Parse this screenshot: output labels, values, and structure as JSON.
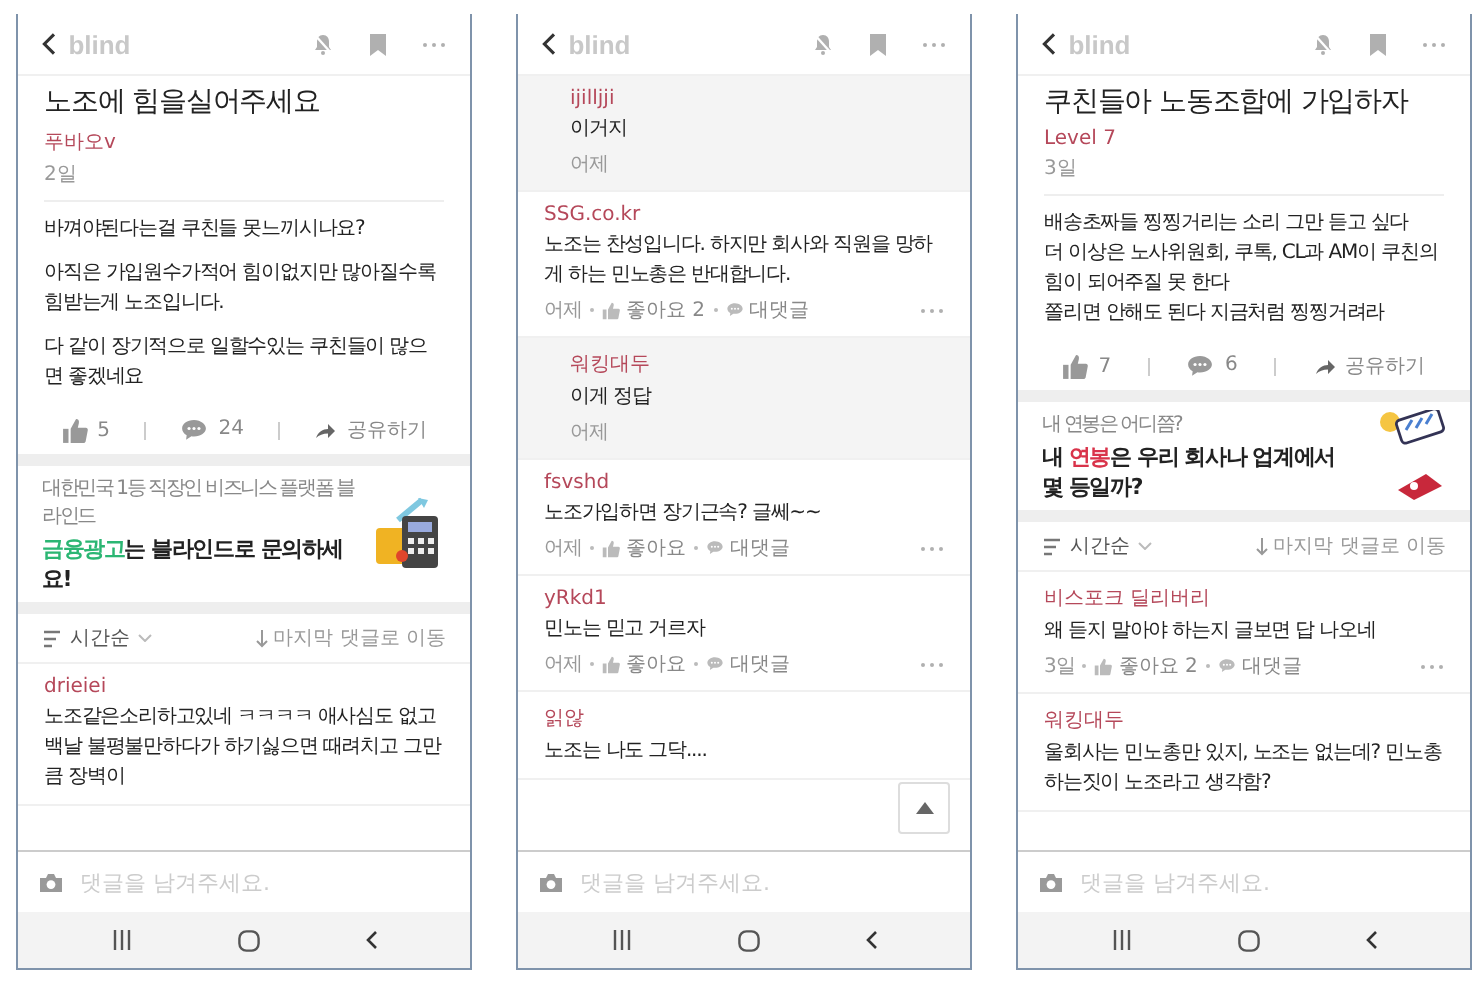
{
  "phones": [
    {
      "logo": "blind",
      "placeholder": "댓글을 남겨주세요.",
      "blocks": [
        {
          "kind": "post",
          "title": "노조에 힘을실어주세요",
          "author": "푸바오v",
          "date": "2일",
          "paragraphs": [
            "바껴야된다는걸 쿠친들 못느끼시나요?",
            "아직은 가입원수가적어 힘이없지만  많아질수록 힘받는게 노조입니다.",
            "다 같이 장기적으로 일할수있는 쿠친들이 많으면 좋겠네요"
          ],
          "likes": "5",
          "comments": "24",
          "share": "공유하기"
        },
        {
          "kind": "ad",
          "caption": "대한민국 1등 직장인 비즈니스 플랫폼 블라인드",
          "color": "#2bb673",
          "headline": [
            {
              "text": "금융광고",
              "accent": true
            },
            {
              "text": "는 블라인드로 문의하세요!",
              "accent": false
            }
          ]
        },
        {
          "kind": "sort",
          "order": "시간순",
          "jump": "마지막 댓글로 이동"
        },
        {
          "kind": "comment",
          "author": "drieiei",
          "text": "노조같은소리하고있네 ㅋㅋㅋㅋ 애사심도 없고 백날 불평불만하다가 하기싫으면 때려치고 그만큼 장벽이"
        }
      ]
    },
    {
      "logo": "blind",
      "placeholder": "댓글을 남겨주세요.",
      "scroll_top_button": true,
      "blocks": [
        {
          "kind": "reply",
          "author": "ijilljji",
          "text": "이거지",
          "meta": {
            "time": "어제"
          }
        },
        {
          "kind": "comment",
          "author": "SSG.co.kr",
          "text": "노조는 찬성입니다. 하지만 회사와 직원을 망하게 하는 민노총은 반대합니다.",
          "meta": {
            "time": "어제",
            "like": "좋아요 2",
            "reply": "대댓글"
          }
        },
        {
          "kind": "reply",
          "author": "워킹대두",
          "text": "이게 정답",
          "meta": {
            "time": "어제"
          }
        },
        {
          "kind": "comment",
          "author": "fsvshd",
          "text": "노조가입하면 장기근속? 글쎄~~",
          "meta": {
            "time": "어제",
            "like": "좋아요",
            "reply": "대댓글"
          }
        },
        {
          "kind": "comment",
          "author": "yRkd1",
          "text": "민노는 믿고 거르자",
          "meta": {
            "time": "어제",
            "like": "좋아요",
            "reply": "대댓글"
          }
        },
        {
          "kind": "comment",
          "author": "읽않",
          "text": "노조는 나도 그닥...."
        }
      ]
    },
    {
      "logo": "blind",
      "placeholder": "댓글을 남겨주세요.",
      "blocks": [
        {
          "kind": "post",
          "title": "쿠친들아 노동조합에 가입하자",
          "author": "Level 7",
          "date": "3일",
          "paragraphs": [
            "배송초짜들 찡찡거리는 소리 그만 듣고 싶다\n더 이상은 노사위원회, 쿠톡, CL과 AM이 쿠친의\n힘이 되어주질 못 한다\n쫄리면 안해도 된다 지금처럼 찡찡거려라"
          ],
          "likes": "7",
          "comments": "6",
          "share": "공유하기"
        },
        {
          "kind": "ad",
          "caption": "내 연봉은 어디쯤?",
          "color": "#d9334a",
          "headline": [
            {
              "text": "내 ",
              "accent": false
            },
            {
              "text": "연봉",
              "accent": true
            },
            {
              "text": "은 우리 회사나 업계에서 몇 등일까?",
              "accent": false
            }
          ]
        },
        {
          "kind": "sort",
          "order": "시간순",
          "jump": "마지막 댓글로 이동"
        },
        {
          "kind": "comment",
          "author": "비스포크 딜리버리",
          "text": "왜 듣지 말아야 하는지 글보면 답 나오네",
          "meta": {
            "time": "3일",
            "like": "좋아요 2",
            "reply": "대댓글"
          }
        },
        {
          "kind": "comment",
          "author": "워킹대두",
          "text": "울회사는 민노총만 있지, 노조는 없는데? 민노총 하는짓이 노조라고 생각함?"
        }
      ]
    }
  ]
}
